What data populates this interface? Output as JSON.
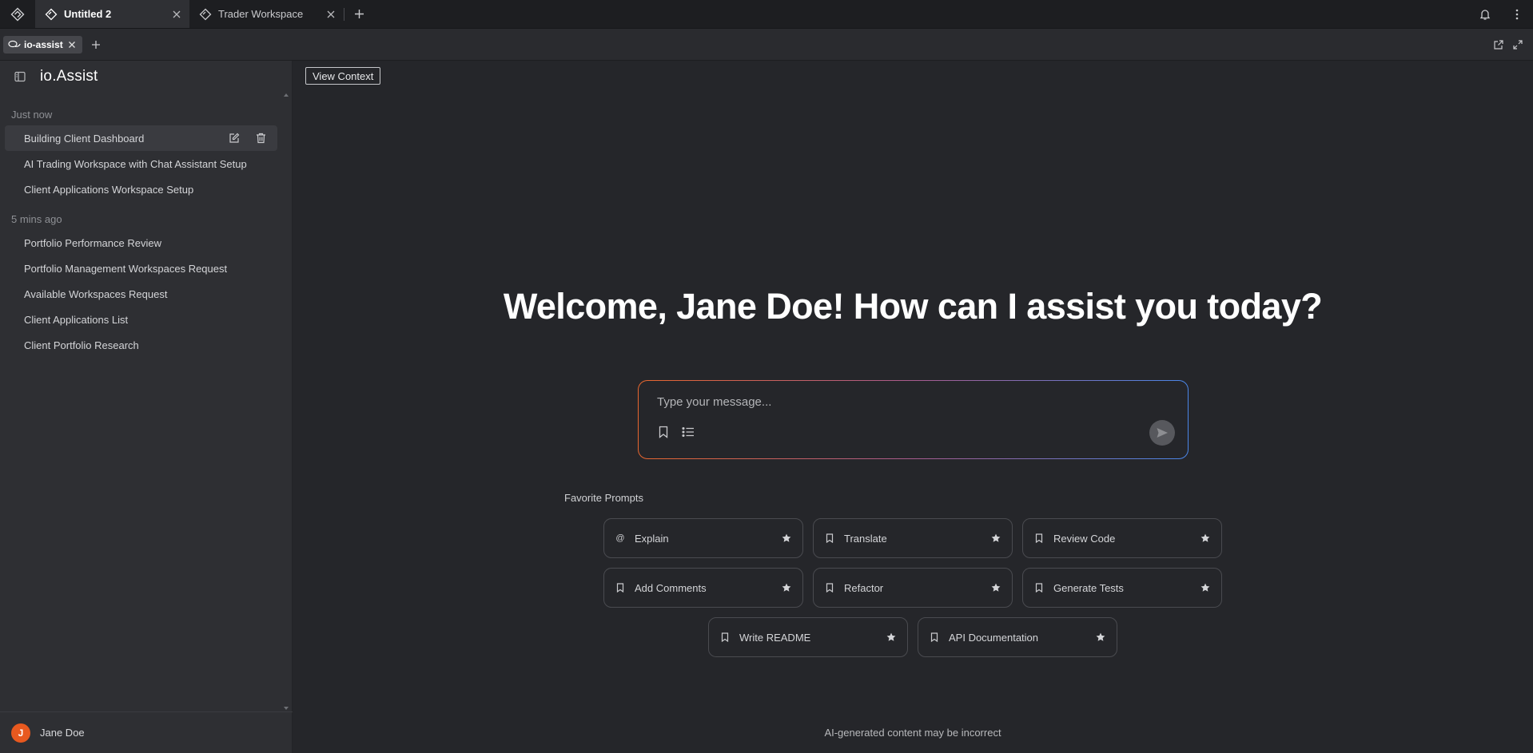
{
  "window_tabs": [
    {
      "label": "Untitled 2",
      "active": true
    },
    {
      "label": "Trader Workspace",
      "active": false
    }
  ],
  "app_tab": {
    "label": "io-assist"
  },
  "sidebar": {
    "title": "io.Assist",
    "groups": [
      {
        "label": "Just now",
        "items": [
          {
            "label": "Building Client Dashboard",
            "selected": true
          },
          {
            "label": "AI Trading Workspace with Chat Assistant Setup"
          },
          {
            "label": "Client Applications Workspace Setup"
          }
        ]
      },
      {
        "label": "5 mins ago",
        "items": [
          {
            "label": "Portfolio Performance Review"
          },
          {
            "label": "Portfolio Management Workspaces Request"
          },
          {
            "label": "Available Workspaces Request"
          },
          {
            "label": "Client Applications List"
          },
          {
            "label": "Client Portfolio Research"
          }
        ]
      }
    ],
    "user": {
      "initial": "J",
      "name": "Jane Doe",
      "avatar_color": "#e8591f"
    }
  },
  "main": {
    "view_context_label": "View Context",
    "welcome": "Welcome, Jane Doe! How can I assist you today?",
    "composer": {
      "placeholder": "Type your message..."
    },
    "favorites_label": "Favorite Prompts",
    "prompts": [
      {
        "label": "Explain",
        "icon": "at-icon"
      },
      {
        "label": "Translate",
        "icon": "bookmark-icon"
      },
      {
        "label": "Review Code",
        "icon": "bookmark-icon"
      },
      {
        "label": "Add Comments",
        "icon": "bookmark-icon"
      },
      {
        "label": "Refactor",
        "icon": "bookmark-icon"
      },
      {
        "label": "Generate Tests",
        "icon": "bookmark-icon"
      },
      {
        "label": "Write README",
        "icon": "bookmark-icon"
      },
      {
        "label": "API Documentation",
        "icon": "bookmark-icon"
      }
    ],
    "disclaimer": "AI-generated content may be incorrect"
  },
  "colors": {
    "accent_orange": "#e8662e",
    "accent_blue": "#4a86e8",
    "background": "#25262a",
    "sidebar": "#2e2f33"
  }
}
